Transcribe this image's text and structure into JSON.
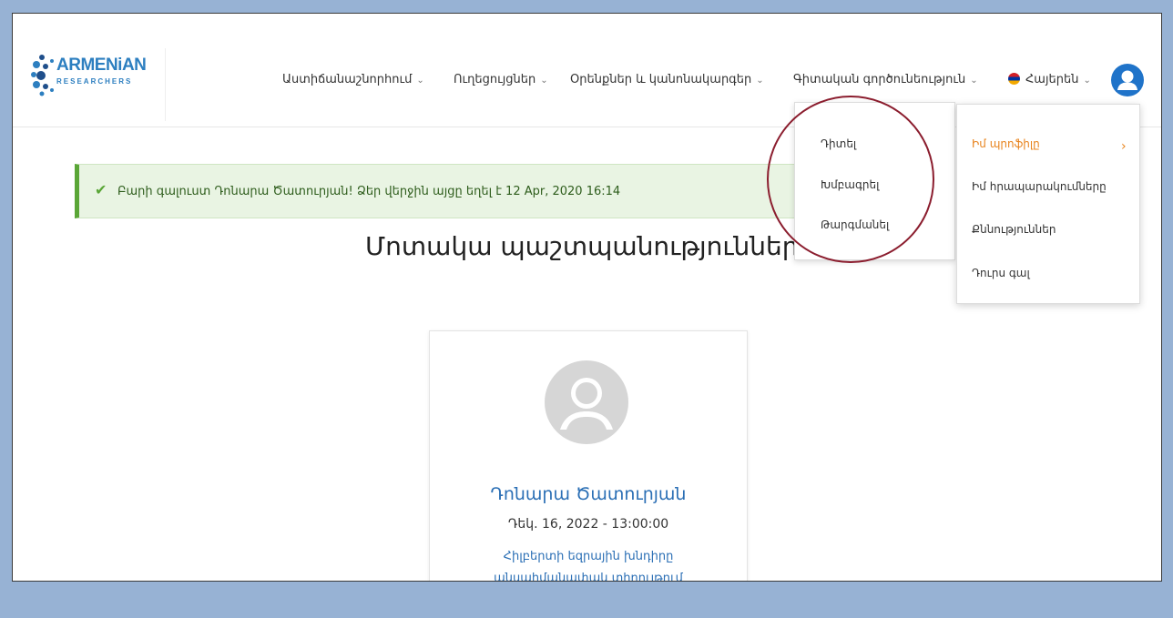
{
  "logo": {
    "word1": "ARMENiAN",
    "word2": "RESEARCHERS"
  },
  "nav": {
    "items": [
      {
        "label": "Աստիճանաշնորհում"
      },
      {
        "label": "Ուղեցույցներ"
      },
      {
        "label": "Օրենքներ և կանոնակարգեր"
      },
      {
        "label": "Գիտական գործունեություն"
      }
    ],
    "language": "Հայերեն",
    "chevron": "⌄"
  },
  "alert": {
    "icon": "check-icon",
    "message": "Բարի գալուստ Դոնարա Ծատուրյան! Ձեր վերջին այցը եղել է 12 Apr, 2020 16:14"
  },
  "page": {
    "title": "Մոտակա պաշտպանություններ"
  },
  "dropdown_actions": {
    "items": [
      {
        "label": "Դիտել"
      },
      {
        "label": "Խմբագրել"
      },
      {
        "label": "Թարգմանել"
      }
    ]
  },
  "dropdown_profile": {
    "items": [
      {
        "label": "Իմ պրոֆիլը",
        "active": true
      },
      {
        "label": "Իմ հրապարակումները"
      },
      {
        "label": "Քննություններ"
      },
      {
        "label": "Դուրս գալ"
      }
    ],
    "arrow": "›"
  },
  "card": {
    "name": "Դոնարա Ծատուրյան",
    "date": "Դեկ. 16, 2022 - 13:00:00",
    "topic_line1": "Հիլբերտի եզրային խնդիրը",
    "topic_line2": "անսահմանափակ տիրույթում"
  },
  "colors": {
    "background": "#97b2d4",
    "accent": "#2b6fb5",
    "active": "#e8841e",
    "alert_border": "#5aa637",
    "annotation_circle": "#8b1d2e"
  }
}
